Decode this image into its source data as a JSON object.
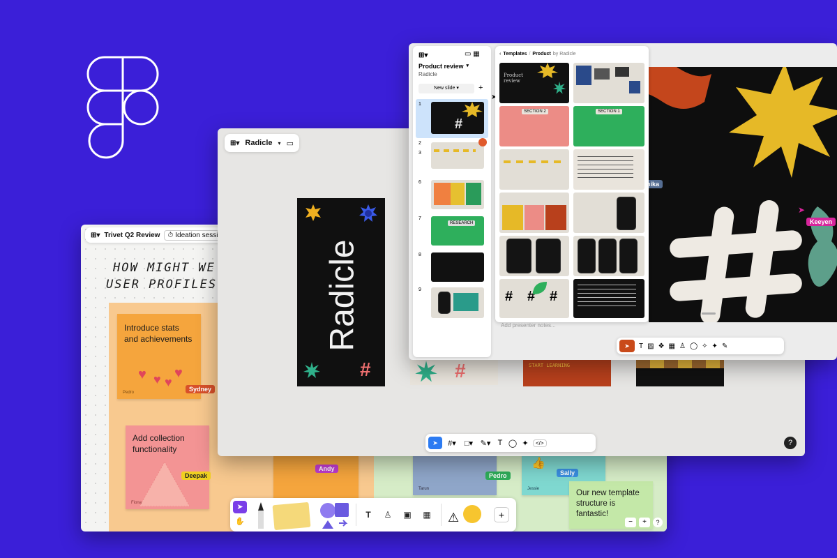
{
  "colors": {
    "background": "#3b1fd8",
    "accent": "#6c3bd8"
  },
  "logo": {
    "name": "figma-logo"
  },
  "board": {
    "title": "Trivet Q2 Review",
    "session": "Ideation session",
    "heading_line1": "HOW MIGHT WE",
    "heading_line2": "USER PROFILES?",
    "stickies": [
      {
        "text": "Introduce stats and achievements",
        "author": "Pedro"
      },
      {
        "text": "Add collection functionality",
        "author": "Fiona"
      },
      {
        "text": "Our new template structure is fantastic!"
      }
    ],
    "small_authors": [
      "Tarun",
      "Jessie"
    ],
    "cursors": [
      "Sydney",
      "Deepak",
      "Andy",
      "Pedro",
      "Sally"
    ],
    "toolbar_plus": "+",
    "zoom_minus": "−",
    "zoom_plus": "+",
    "help": "?"
  },
  "slides_editor": {
    "file_label": "Radicle",
    "slide_title": "Radicle",
    "help": "?",
    "code_icon": "</>"
  },
  "presentation": {
    "file_title": "Product review",
    "team": "Radicle",
    "new_slide": "New slide",
    "add": "+",
    "slide_numbers": [
      "1",
      "2",
      "3",
      "6",
      "7",
      "8",
      "9"
    ],
    "slide_research_label": "RESEARCH",
    "breadcrumb_templates": "Templates",
    "breadcrumb_sep": "/",
    "breadcrumb_product": "Product",
    "breadcrumb_by": "by Radicle",
    "template_section2": "SECTION 2",
    "template_section1": "SECTION 1",
    "template_cover_title": "Product review",
    "presenter_notes": "Add presenter notes...",
    "cursor_keeyen": "Keeyen",
    "cursor_partial": "nika",
    "strip_text": "START LEARNING"
  }
}
